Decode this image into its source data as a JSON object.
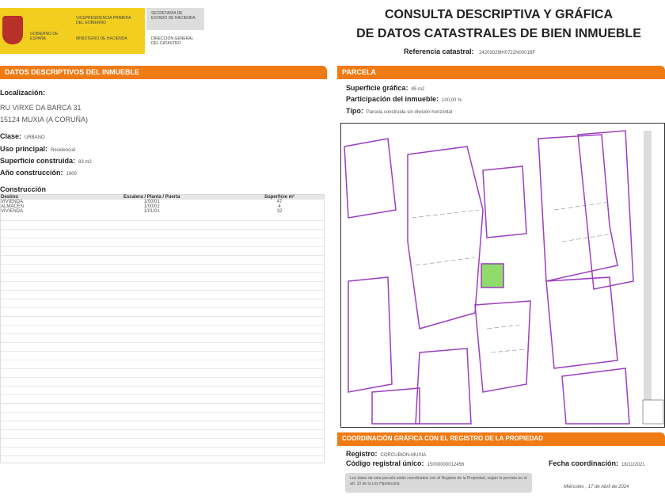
{
  "header": {
    "gov": "GOBIERNO DE ESPAÑA",
    "vice": "VICEPRESIDENCIA PRIMERA DEL GOBIERNO",
    "ministry": "MINISTERIO DE HACIENDA",
    "secretary": "SECRETARÍA DE ESTADO DE HACIENDA",
    "direction": "DIRECCIÓN GENERAL DEL CATASTRO",
    "title1": "CONSULTA DESCRIPTIVA Y GRÁFICA",
    "title2": "DE DATOS CATASTRALES DE BIEN INMUEBLE",
    "ref_label": "Referencia catastral:",
    "ref_value": "2420302MH0722N0001BF"
  },
  "datos": {
    "band": "DATOS DESCRIPTIVOS DEL INMUEBLE",
    "loc_label": "Localización:",
    "loc1": "RU VIRXE DA BARCA 31",
    "loc2": "15124 MUXIA (A CORUÑA)",
    "clase_label": "Clase:",
    "clase": "URBANO",
    "uso_label": "Uso principal:",
    "uso": "Residencial",
    "sup_label": "Superficie construida:",
    "sup": "83 m2",
    "anio_label": "Año construcción:",
    "anio": "1900",
    "constr_label": "Construcción",
    "cols": [
      "Destino",
      "Escalera / Planta / Puerta",
      "Superficie m²"
    ],
    "rows": [
      [
        "VIVIENDA",
        "1/00/01",
        "47"
      ],
      [
        "ALMACEN",
        "1/00/02",
        "4"
      ],
      [
        "VIVIENDA",
        "1/01/01",
        "32"
      ]
    ]
  },
  "parcela": {
    "band": "PARCELA",
    "sup_label": "Superficie gráfica:",
    "sup": "85 m2",
    "part_label": "Participación del inmueble:",
    "part": "100,00 %",
    "tipo_label": "Tipo:",
    "tipo": "Parcela construida sin división horizontal"
  },
  "coord": {
    "band": "COORDINACIÓN GRÁFICA CON EL REGISTRO DE LA PROPIEDAD",
    "reg_label": "Registro:",
    "reg": "CORCUBION-MUXIA",
    "cru_label": "Código registral único:",
    "cru": "15000000012456",
    "fecha_label": "Fecha coordinación:",
    "fecha": "18/11/2021",
    "note": "Los datos de esta parcela están coordinados con el Registro de la Propiedad, según lo previsto en el art. 10 de la Ley Hipotecaria",
    "date": "Miércoles , 17 de Abril de 2024"
  },
  "colors": {
    "orange": "#f07a14",
    "parcel": "#9b3fbf",
    "highlight": "#8fdc6a"
  }
}
